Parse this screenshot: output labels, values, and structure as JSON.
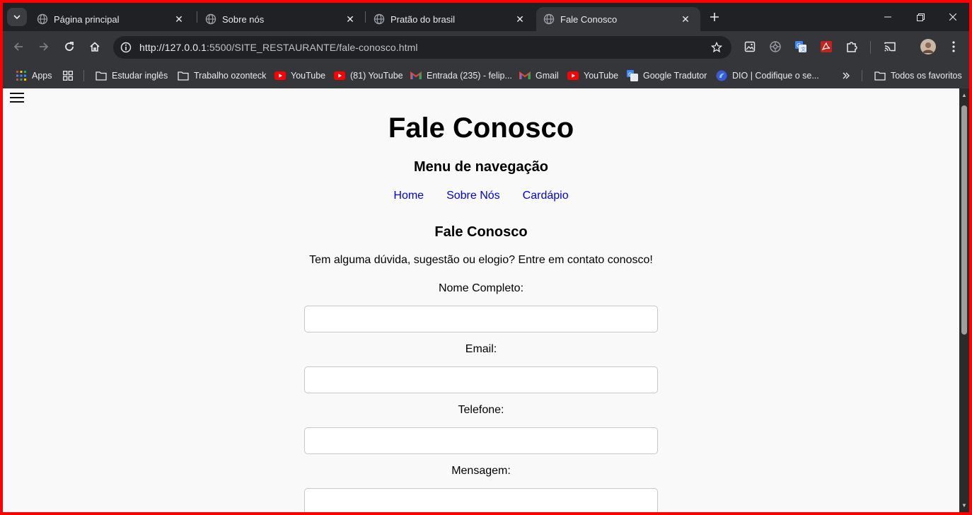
{
  "browser": {
    "tabs": [
      {
        "title": "Página principal",
        "active": false
      },
      {
        "title": "Sobre nós",
        "active": false
      },
      {
        "title": "Pratão do brasil",
        "active": false
      },
      {
        "title": "Fale Conosco",
        "active": true
      }
    ],
    "url": {
      "host": "http://127.0.0.1",
      "path": ":5500/SITE_RESTAURANTE/fale-conosco.html"
    },
    "bookmarks": [
      {
        "label": "Apps",
        "icon": "apps-grid-icon"
      },
      {
        "label": "Estudar inglês",
        "icon": "folder-icon"
      },
      {
        "label": "Trabalho ozonteck",
        "icon": "folder-icon"
      },
      {
        "label": "YouTube",
        "icon": "youtube-icon"
      },
      {
        "label": "(81) YouTube",
        "icon": "youtube-icon"
      },
      {
        "label": "Entrada (235) - felip...",
        "icon": "gmail-icon"
      },
      {
        "label": "Gmail",
        "icon": "gmail-icon"
      },
      {
        "label": "YouTube",
        "icon": "youtube-icon"
      },
      {
        "label": "Google Tradutor",
        "icon": "google-translate-icon"
      },
      {
        "label": "DIO | Codifique o se...",
        "icon": "dio-icon"
      }
    ],
    "all_bookmarks_label": "Todos os favoritos",
    "colors": {
      "frame_border": "#ff0000",
      "chrome_dark": "#202124",
      "toolbar": "#35363a",
      "link": "#0000ee"
    }
  },
  "page": {
    "title": "Fale Conosco",
    "nav_heading": "Menu de navegação",
    "nav_links": [
      "Home",
      "Sobre Nós",
      "Cardápio"
    ],
    "section_heading": "Fale Conosco",
    "intro": "Tem alguma dúvida, sugestão ou elogio? Entre em contato conosco!",
    "form": {
      "name_label": "Nome Completo:",
      "email_label": "Email:",
      "phone_label": "Telefone:",
      "message_label": "Mensagem:"
    }
  }
}
